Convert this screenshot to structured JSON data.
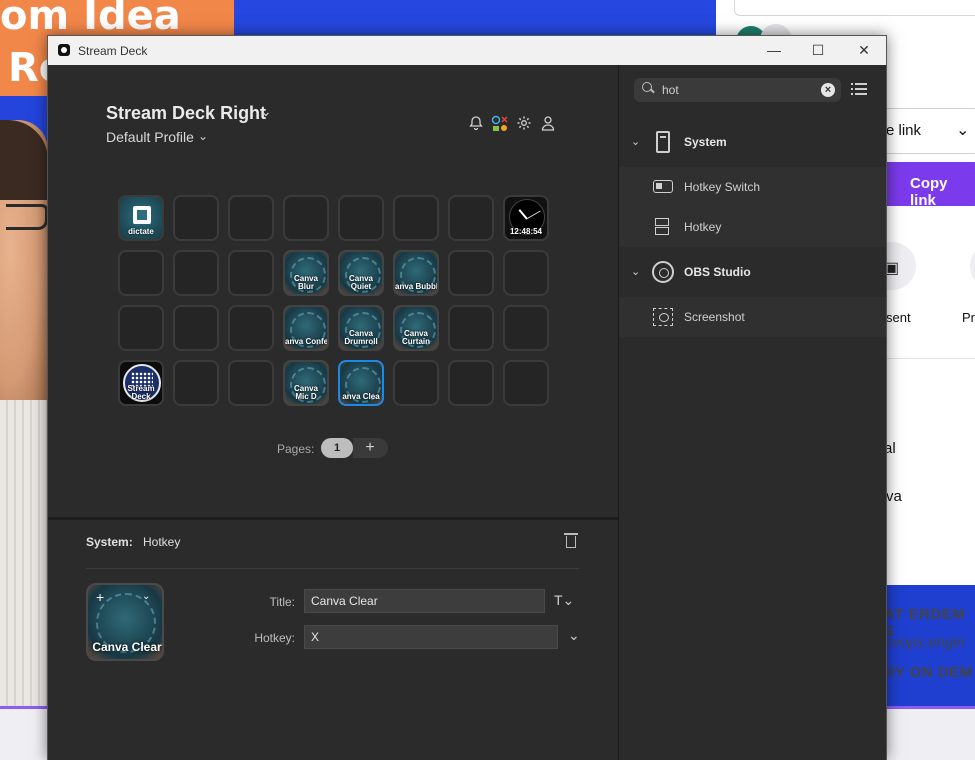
{
  "background": {
    "banner_line1": "om Idea",
    "banner_line2": "Ro",
    "right_panel": {
      "select_text": "e link",
      "copy_button": "Copy link",
      "present_label": "sent",
      "pr_label": "Pr",
      "text_al": "al",
      "text_va": "va",
      "footer_line1": "AT ERDEM S",
      "footer_line2": "evops.engin",
      "footer_line3": "RY ON DEM"
    }
  },
  "window": {
    "title": "Stream Deck",
    "controls": {
      "minimize": "—",
      "maximize": "☐",
      "close": "✕"
    }
  },
  "header": {
    "device_name": "Stream Deck Right",
    "profile_name": "Default Profile",
    "icons": [
      "bell-icon",
      "plugins-icon",
      "gear-icon",
      "account-icon"
    ]
  },
  "keys": [
    {
      "label": "dictate",
      "kind": "dictate"
    },
    {
      "label": "",
      "kind": "empty"
    },
    {
      "label": "",
      "kind": "empty"
    },
    {
      "label": "",
      "kind": "empty"
    },
    {
      "label": "",
      "kind": "empty"
    },
    {
      "label": "",
      "kind": "empty"
    },
    {
      "label": "",
      "kind": "empty"
    },
    {
      "label": "12:48:54",
      "kind": "clock"
    },
    {
      "label": "",
      "kind": "empty"
    },
    {
      "label": "",
      "kind": "empty"
    },
    {
      "label": "",
      "kind": "empty"
    },
    {
      "label": "Canva\nBlur",
      "kind": "img"
    },
    {
      "label": "Canva\nQuiet",
      "kind": "img"
    },
    {
      "label": "anva Bubbl",
      "kind": "img"
    },
    {
      "label": "",
      "kind": "empty"
    },
    {
      "label": "",
      "kind": "empty"
    },
    {
      "label": "",
      "kind": "empty"
    },
    {
      "label": "",
      "kind": "empty"
    },
    {
      "label": "",
      "kind": "empty"
    },
    {
      "label": "anva Confe",
      "kind": "img"
    },
    {
      "label": "Canva\nDrumroll",
      "kind": "img"
    },
    {
      "label": "Canva\nCurtain",
      "kind": "img"
    },
    {
      "label": "",
      "kind": "empty"
    },
    {
      "label": "",
      "kind": "empty"
    },
    {
      "label": "Stream\nDeck",
      "kind": "sd"
    },
    {
      "label": "",
      "kind": "empty"
    },
    {
      "label": "",
      "kind": "empty"
    },
    {
      "label": "Canva\nMic D",
      "kind": "img"
    },
    {
      "label": "anva Clea",
      "kind": "img",
      "selected": true
    },
    {
      "label": "",
      "kind": "empty"
    },
    {
      "label": "",
      "kind": "empty"
    },
    {
      "label": "",
      "kind": "empty"
    }
  ],
  "pages": {
    "label": "Pages:",
    "current": "1",
    "add": "+"
  },
  "inspector": {
    "type_label": "System:",
    "action_name": "Hotkey",
    "key_label": "Canva Clear",
    "title_label": "Title:",
    "title_value": "Canva Clear",
    "hotkey_label": "Hotkey:",
    "hotkey_value": "X"
  },
  "actions_panel": {
    "search_value": "hot",
    "categories": [
      {
        "name": "System",
        "icon": "computer-tower-icon",
        "items": [
          {
            "name": "Hotkey Switch",
            "icon": "hotkey-switch-icon"
          },
          {
            "name": "Hotkey",
            "icon": "hotkey-icon"
          }
        ]
      },
      {
        "name": "OBS Studio",
        "icon": "obs-logo-icon",
        "items": [
          {
            "name": "Screenshot",
            "icon": "screenshot-icon"
          }
        ]
      }
    ]
  },
  "colors": {
    "window_bg": "#2b2b2b",
    "selected_key_border": "#1e88e5",
    "copy_button_bg": "#7c3aed"
  }
}
